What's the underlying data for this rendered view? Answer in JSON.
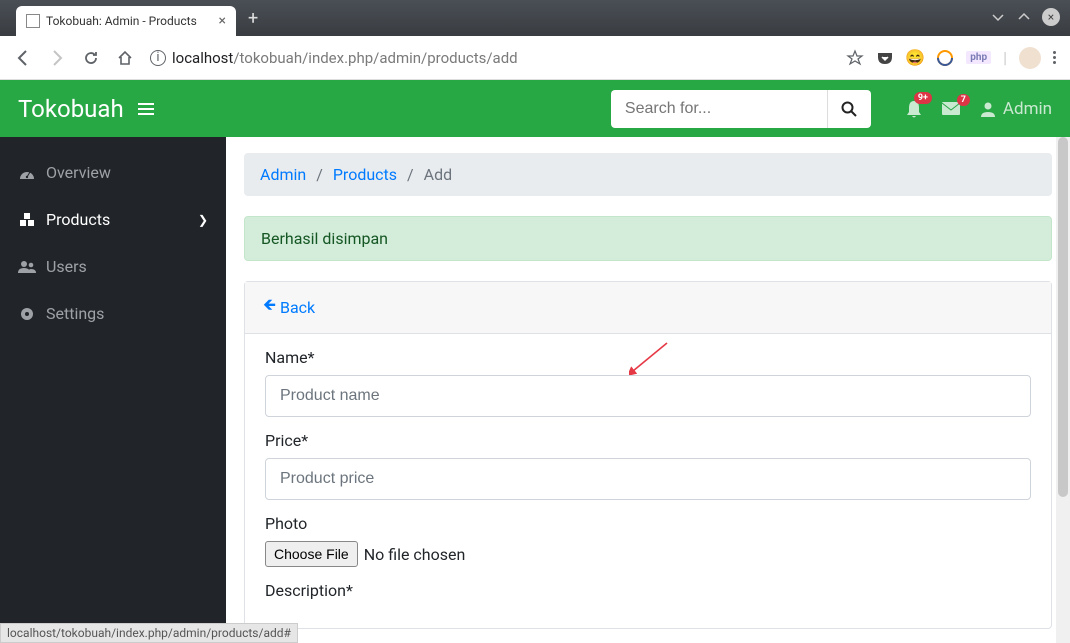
{
  "browser": {
    "tab_title": "Tokobuah: Admin - Products",
    "url_host": "localhost",
    "url_path": "/tokobuah/index.php/admin/products/add",
    "php_label": "php",
    "status_url": "localhost/tokobuah/index.php/admin/products/add#"
  },
  "topbar": {
    "brand": "Tokobuah",
    "search_placeholder": "Search for...",
    "bell_badge": "9+",
    "mail_badge": "7",
    "admin_label": "Admin"
  },
  "sidebar": {
    "items": [
      {
        "label": "Overview"
      },
      {
        "label": "Products"
      },
      {
        "label": "Users"
      },
      {
        "label": "Settings"
      }
    ]
  },
  "breadcrumb": {
    "a": "Admin",
    "b": "Products",
    "c": "Add"
  },
  "alert": "Berhasil disimpan",
  "back_label": "Back",
  "form": {
    "name_label": "Name*",
    "name_placeholder": "Product name",
    "price_label": "Price*",
    "price_placeholder": "Product price",
    "photo_label": "Photo",
    "choose_file": "Choose File",
    "no_file": "No file chosen",
    "description_label": "Description*"
  }
}
